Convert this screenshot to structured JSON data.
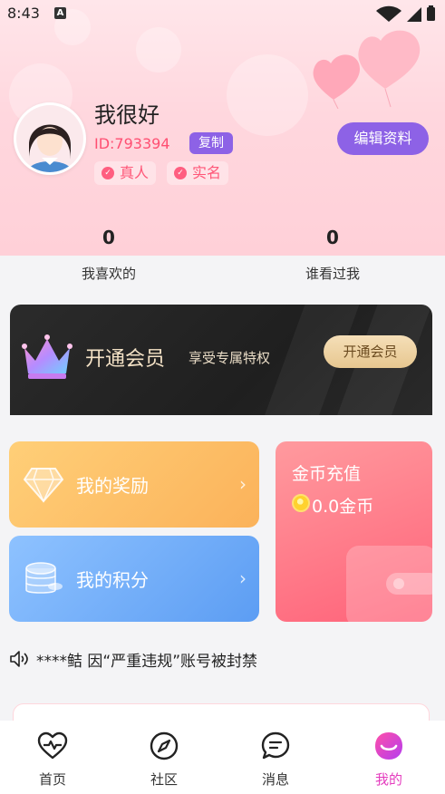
{
  "status_bar": {
    "time": "8:43",
    "notification_badge": "A"
  },
  "profile": {
    "nickname": "我很好",
    "user_id": "ID:793394",
    "copy_label": "复制",
    "tags": [
      "真人",
      "实名"
    ],
    "edit_label": "编辑资料"
  },
  "stats": [
    {
      "value": "0",
      "label": "我喜欢的"
    },
    {
      "value": "0",
      "label": "谁看过我"
    }
  ],
  "vip": {
    "title": "开通会员",
    "subtitle": "享受专属特权",
    "button": "开通会员"
  },
  "cards": {
    "rewards": "我的奖励",
    "points": "我的积分",
    "coins_title": "金币充值",
    "coins_amount": "0.0金币"
  },
  "notice": {
    "text": "****鲒 因“严重违规”账号被封禁"
  },
  "tabbar": [
    {
      "label": "首页",
      "icon": "heart-pulse-icon"
    },
    {
      "label": "社区",
      "icon": "compass-icon"
    },
    {
      "label": "消息",
      "icon": "chat-bubble-icon"
    },
    {
      "label": "我的",
      "icon": "profile-face-icon",
      "active": true
    }
  ],
  "colors": {
    "accent_purple": "#8d62e6",
    "accent_pink": "#ff4f72",
    "tab_active": "#e43cbe"
  }
}
